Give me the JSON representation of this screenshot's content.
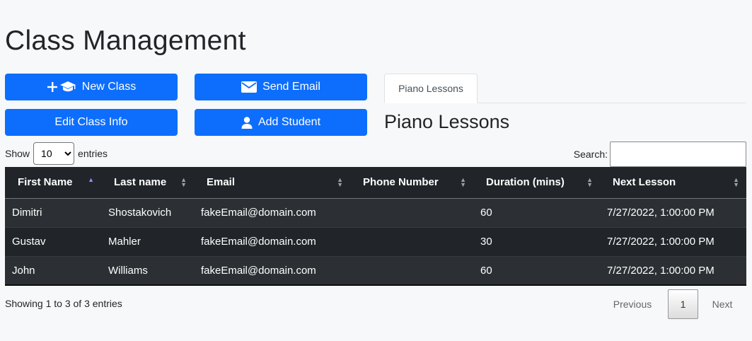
{
  "page": {
    "title": "Class Management"
  },
  "buttons": {
    "new_class": "New Class",
    "send_email": "Send Email",
    "edit_class": "Edit Class Info",
    "add_student": "Add Student"
  },
  "tabs": [
    {
      "label": "Piano Lessons",
      "active": true
    }
  ],
  "section": {
    "title": "Piano Lessons"
  },
  "table_controls": {
    "show_label": "Show",
    "entries_value": "10",
    "entries_label": "entries",
    "search_label": "Search:",
    "search_value": ""
  },
  "table": {
    "columns": [
      "First Name",
      "Last name",
      "Email",
      "Phone Number",
      "Duration (mins)",
      "Next Lesson"
    ],
    "sorted_column": "First Name",
    "sort_direction": "asc",
    "rows": [
      [
        "Dimitri",
        "Shostakovich",
        "fakeEmail@domain.com",
        "",
        "60",
        "7/27/2022, 1:00:00 PM"
      ],
      [
        "Gustav",
        "Mahler",
        "fakeEmail@domain.com",
        "",
        "30",
        "7/27/2022, 1:00:00 PM"
      ],
      [
        "John",
        "Williams",
        "fakeEmail@domain.com",
        "",
        "60",
        "7/27/2022, 1:00:00 PM"
      ]
    ]
  },
  "footer": {
    "info": "Showing 1 to 3 of 3 entries",
    "previous": "Previous",
    "current_page": "1",
    "next": "Next"
  },
  "colors": {
    "primary": "#0d6efd",
    "table_dark": "#212529",
    "table_stripe": "#2c3034"
  },
  "icons": {
    "new_class": [
      "plus-icon",
      "graduation-cap-icon"
    ],
    "send_email": "envelope-icon",
    "add_student": "person-icon"
  }
}
